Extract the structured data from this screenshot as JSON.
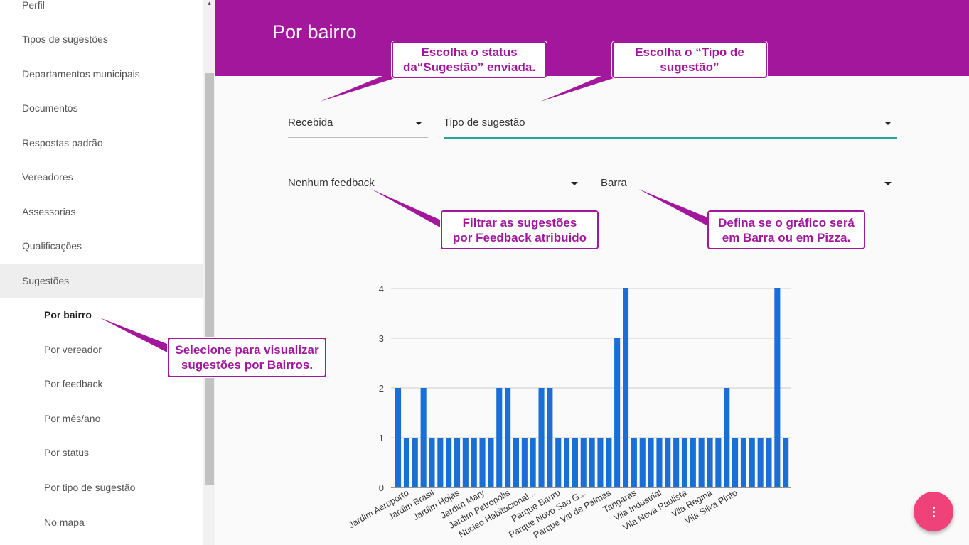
{
  "sidebar": {
    "items": [
      {
        "label": "Perfil"
      },
      {
        "label": "Tipos de sugestões"
      },
      {
        "label": "Departamentos municipais"
      },
      {
        "label": "Documentos"
      },
      {
        "label": "Respostas padrão"
      },
      {
        "label": "Vereadores"
      },
      {
        "label": "Assessorias"
      },
      {
        "label": "Qualificações"
      },
      {
        "label": "Sugestões"
      }
    ],
    "subitems": [
      {
        "label": "Por bairro"
      },
      {
        "label": "Por vereador"
      },
      {
        "label": "Por feedback"
      },
      {
        "label": "Por mês/ano"
      },
      {
        "label": "Por status"
      },
      {
        "label": "Por tipo de sugestão"
      },
      {
        "label": "No mapa"
      }
    ]
  },
  "header": {
    "title": "Por bairro"
  },
  "filters": {
    "status": "Recebida",
    "tipo": "Tipo de sugestão",
    "feedback": "Nenhum feedback",
    "chart_type": "Barra"
  },
  "callouts": {
    "status": [
      "Escolha o status",
      "da“Sugestão” enviada."
    ],
    "tipo": [
      "Escolha o “Tipo de",
      "sugestão”"
    ],
    "feedback": [
      "Filtrar as sugestões",
      "por Feedback atribuido"
    ],
    "chart_type": [
      "Defina se o gráfico será",
      "em Barra ou em Pizza."
    ],
    "bairro": [
      "Selecione para visualizar",
      "sugestões por Bairros."
    ]
  },
  "colors": {
    "accent": "#a3179d",
    "bar": "#1a6fd6",
    "fab": "#f0427a"
  },
  "icons": {
    "fab": "more-vert-icon",
    "caret": "arrow-drop-down-icon"
  },
  "chart_data": {
    "type": "bar",
    "ylim": [
      0,
      4
    ],
    "yticks": [
      0,
      1,
      2,
      3,
      4
    ],
    "visible_labels": [
      "Jardim Aeroporto",
      "Jardim Brasil",
      "Jardim Hojas",
      "Jardim Mary",
      "Jardim Petropolis",
      "Núcleo Habitacional...",
      "Parque Bauru",
      "Parque Novo Sao G...",
      "Parque Val de Palmas",
      "Tangarás",
      "Vila Industrial",
      "Vila Nova Paulista",
      "Vila Regina",
      "Vila Silva Pinto"
    ],
    "values": [
      2,
      1,
      1,
      2,
      1,
      1,
      1,
      1,
      1,
      1,
      1,
      1,
      2,
      2,
      1,
      1,
      1,
      2,
      2,
      1,
      1,
      1,
      1,
      1,
      1,
      1,
      3,
      4,
      1,
      1,
      1,
      1,
      1,
      1,
      1,
      1,
      1,
      1,
      1,
      2,
      1,
      1,
      1,
      1,
      1,
      4,
      1
    ]
  }
}
